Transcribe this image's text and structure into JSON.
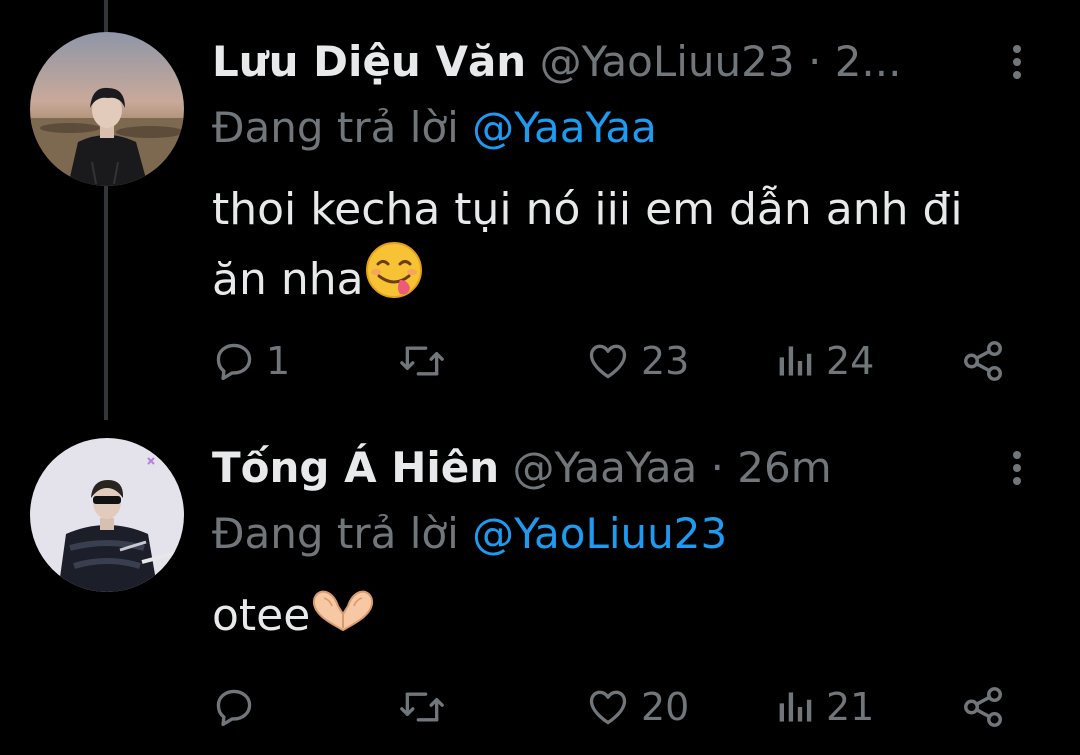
{
  "tweets": [
    {
      "name": "Lưu Diệu Văn",
      "handle": "@YaoLiuu23",
      "separator": "·",
      "time": "2...",
      "replying_label": "Đang trả lời",
      "replying_to": "@YaaYaa",
      "text_line1": "thoi kecha tụi nó iii em dẫn anh đi",
      "text_line2": "ăn nha",
      "emoji": "face-savoring-food-icon",
      "reply_count": "1",
      "retweet_count": "",
      "like_count": "23",
      "view_count": "24"
    },
    {
      "name": "Tống Á Hiên",
      "handle": "@YaaYaa",
      "separator": "·",
      "time": "26m",
      "replying_label": "Đang trả lời",
      "replying_to": "@YaoLiuu23",
      "text_line1": "otee",
      "emoji": "heart-hands-icon",
      "reply_count": "",
      "retweet_count": "",
      "like_count": "20",
      "view_count": "21"
    }
  ],
  "colors": {
    "background": "#000000",
    "primary_text": "#e7e9ea",
    "secondary_text": "#71767b",
    "accent": "#1d9bf0",
    "thread_line": "#333639"
  }
}
